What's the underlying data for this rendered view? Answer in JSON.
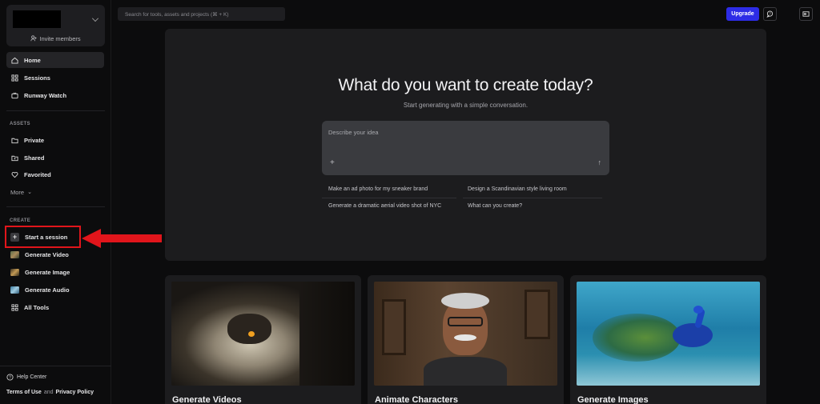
{
  "sidebar": {
    "invite_label": "Invite members",
    "nav": [
      {
        "label": "Home",
        "icon": "home-icon"
      },
      {
        "label": "Sessions",
        "icon": "sessions-icon"
      },
      {
        "label": "Runway Watch",
        "icon": "tv-icon"
      }
    ],
    "assets_label": "ASSETS",
    "assets": [
      {
        "label": "Private",
        "icon": "folder-icon"
      },
      {
        "label": "Shared",
        "icon": "shared-folder-icon"
      },
      {
        "label": "Favorited",
        "icon": "heart-icon"
      }
    ],
    "more_label": "More",
    "create_label": "CREATE",
    "create": [
      {
        "label": "Start a session",
        "icon": "plus-icon"
      },
      {
        "label": "Generate Video",
        "icon": "video-thumb-icon"
      },
      {
        "label": "Generate Image",
        "icon": "image-thumb-icon"
      },
      {
        "label": "Generate Audio",
        "icon": "audio-thumb-icon"
      },
      {
        "label": "All Tools",
        "icon": "grid-icon"
      }
    ],
    "help_label": "Help Center",
    "terms_label": "Terms of Use",
    "and_label": "and",
    "privacy_label": "Privacy Policy"
  },
  "topbar": {
    "search_placeholder": "Search for tools, assets and projects (⌘ + K)",
    "upgrade_label": "Upgrade"
  },
  "hero": {
    "title": "What do you want to create today?",
    "subtitle": "Start generating with a simple conversation.",
    "prompt_placeholder": "Describe your idea",
    "suggestions": [
      "Make an ad photo for my sneaker brand",
      "Design a Scandinavian style living room",
      "Generate a dramatic aerial video shot of NYC",
      "What can you create?"
    ]
  },
  "cards": [
    {
      "title": "Generate Videos"
    },
    {
      "title": "Animate Characters"
    },
    {
      "title": "Generate Images"
    }
  ],
  "colors": {
    "accent": "#2d2ce6",
    "annotation": "#e1151b"
  }
}
